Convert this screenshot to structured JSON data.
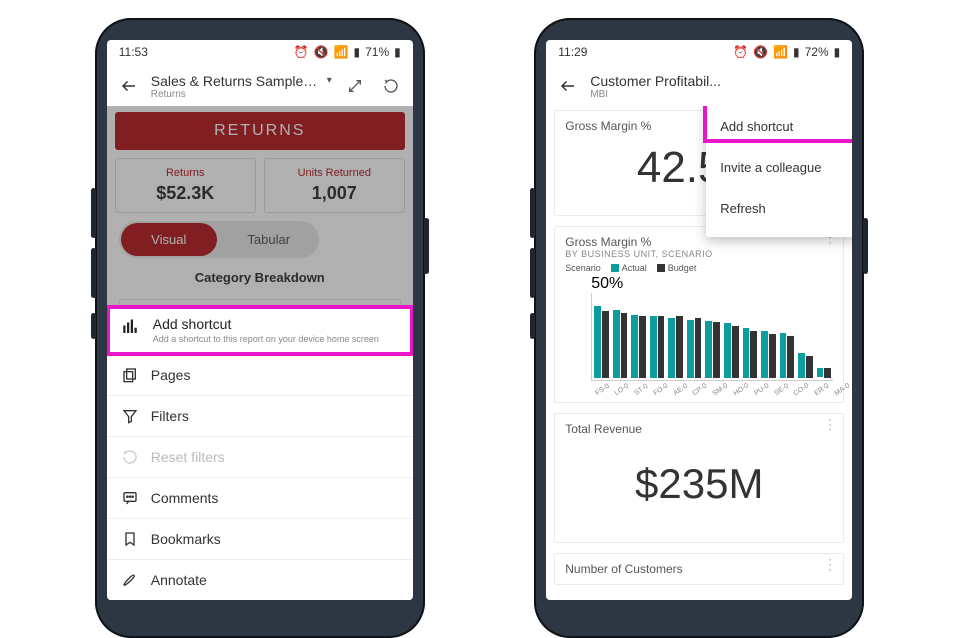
{
  "phone1": {
    "status": {
      "time": "11:53",
      "battery": "71%"
    },
    "header": {
      "title": "Sales & Returns Sample v...",
      "subtitle": "Returns"
    },
    "banner": "RETURNS",
    "kpis": [
      {
        "label": "Returns",
        "value": "$52.3K"
      },
      {
        "label": "Units Returned",
        "value": "1,007"
      }
    ],
    "tabs": {
      "visual": "Visual",
      "tabular": "Tabular"
    },
    "section": "Category Breakdown",
    "sheet": {
      "add_shortcut_title": "Add shortcut",
      "add_shortcut_sub": "Add a shortcut to this report on your device home screen",
      "pages": "Pages",
      "filters": "Filters",
      "reset_filters": "Reset filters",
      "comments": "Comments",
      "bookmarks": "Bookmarks",
      "annotate": "Annotate"
    }
  },
  "phone2": {
    "status": {
      "time": "11:29",
      "battery": "72%"
    },
    "header": {
      "title": "Customer Profitabil...",
      "subtitle": "MBI"
    },
    "menu": {
      "add_shortcut": "Add shortcut",
      "invite": "Invite a colleague",
      "refresh": "Refresh"
    },
    "gross_margin": {
      "title": "Gross Margin %",
      "value": "42.5%"
    },
    "gm_chart": {
      "title": "Gross Margin %",
      "subtitle": "BY BUSINESS UNIT, SCENARIO",
      "legend_label": "Scenario",
      "legend_actual": "Actual",
      "legend_budget": "Budget"
    },
    "total_revenue": {
      "title": "Total Revenue",
      "value": "$235M"
    },
    "num_customers": {
      "title": "Number of Customers"
    }
  },
  "chart_data": {
    "type": "bar",
    "title": "Gross Margin %",
    "xlabel": "Business Unit",
    "ylabel": "Gross Margin %",
    "ylim": [
      -10,
      60
    ],
    "y_tick_label": "50%",
    "legend_title": "Scenario",
    "categories": [
      "FS-0",
      "LO-0",
      "ST-0",
      "FO-0",
      "AE-0",
      "CP-0",
      "SM-0",
      "HO-0",
      "PU-0",
      "SE-0",
      "CO-0",
      "ER-0",
      "MA-0"
    ],
    "series": [
      {
        "name": "Actual",
        "values_pct": [
          58,
          55,
          51,
          50,
          48,
          47,
          46,
          44,
          40,
          38,
          36,
          20,
          -7
        ]
      },
      {
        "name": "Budget",
        "values_pct": [
          54,
          52,
          50,
          50,
          50,
          48,
          45,
          42,
          38,
          35,
          34,
          18,
          8
        ]
      }
    ]
  }
}
